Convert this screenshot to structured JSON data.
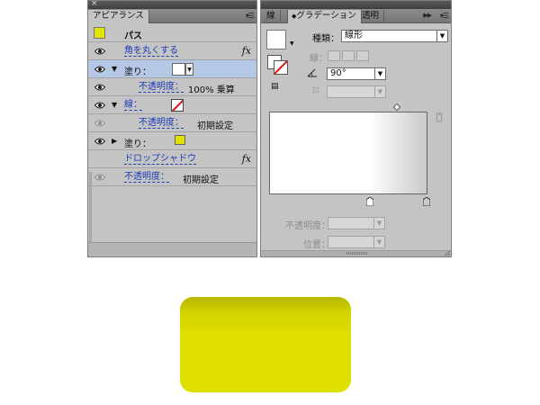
{
  "appearance_panel": {
    "tab": "アピアランス",
    "rows": {
      "path": "パス",
      "round_corners": "角を丸くする",
      "fill1": "塗り：",
      "fill1_opacity_label": "不透明度：",
      "fill1_opacity_value": "100% 乗算",
      "stroke": "線：",
      "stroke_opacity_label": "不透明度：",
      "stroke_opacity_value": "初期設定",
      "fill2": "塗り：",
      "drop_shadow": "ドロップシャドウ",
      "object_opacity_label": "不透明度：",
      "object_opacity_value": "初期設定"
    },
    "fx_label": "fx",
    "colors": {
      "path_swatch": "#e4e400",
      "fill2_swatch": "#e2e200",
      "selected_row": "#b5c9e6"
    }
  },
  "gradient_panel": {
    "tabs": {
      "stroke": "線",
      "gradient": "グラデーション",
      "transparency": "透明"
    },
    "type_label": "種類：",
    "type_value": "線形",
    "stroke_label": "線：",
    "angle_value": "90°",
    "opacity_label": "不透明度：",
    "location_label": "位置：",
    "ramp": {
      "start_color": "#ffffff",
      "end_color": "#c9c9c9",
      "start_stop_percent": 63,
      "end_stop_percent": 100,
      "midpoint_percent": 81
    }
  },
  "canvas": {
    "shape_color": "#dede00",
    "shape_top_shade": "#b8b800"
  }
}
